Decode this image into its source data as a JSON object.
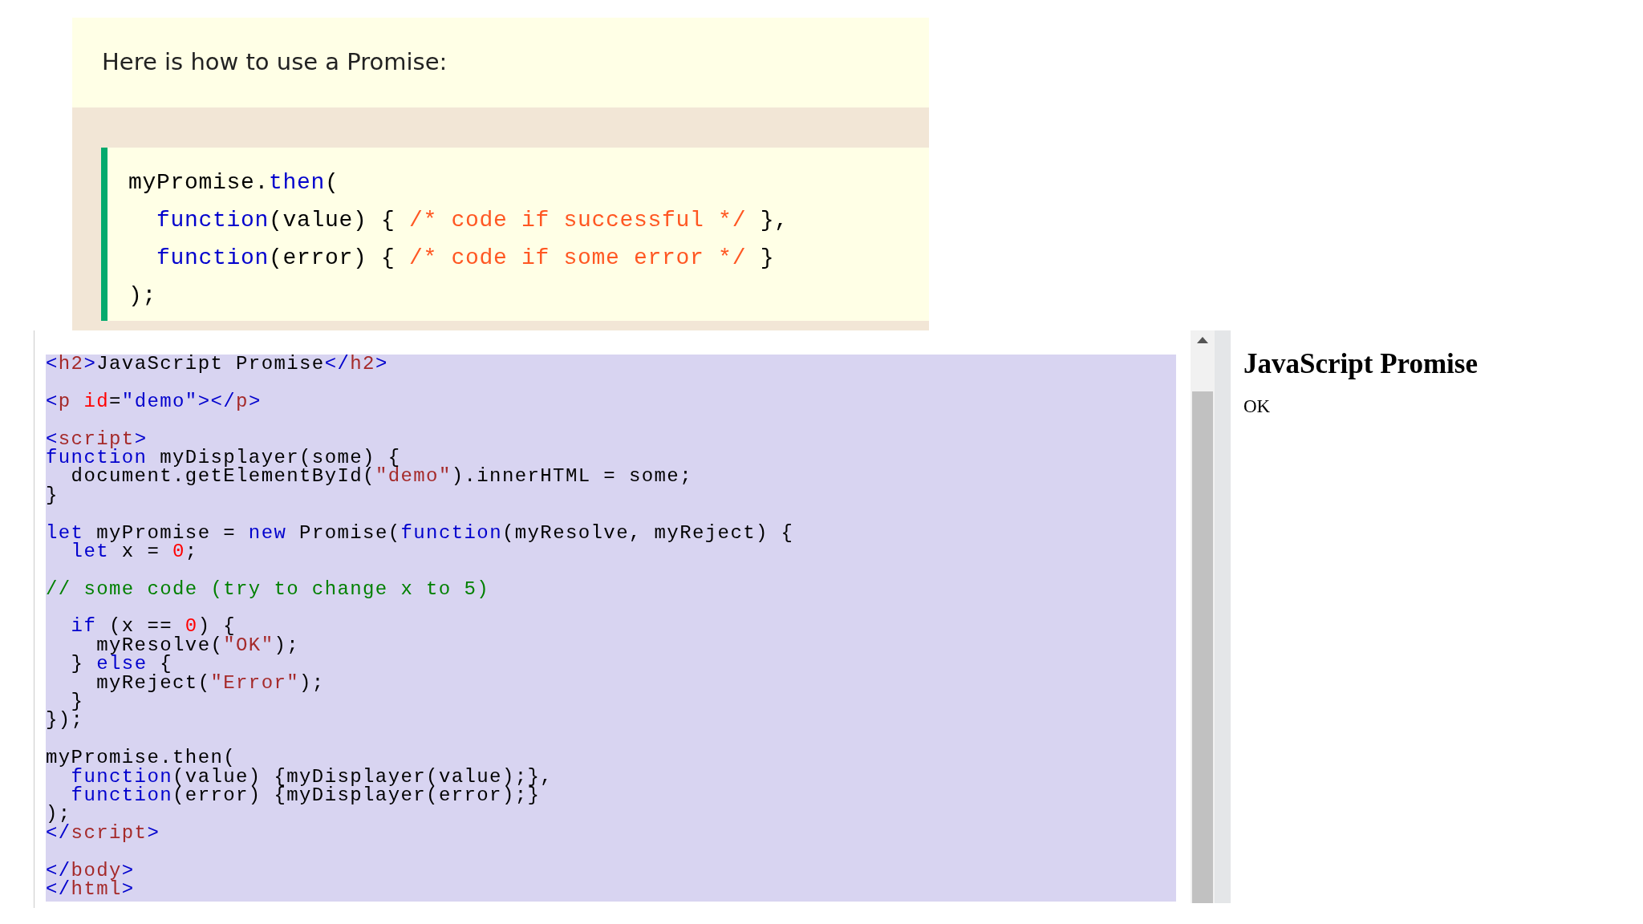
{
  "note": {
    "text": "Here is how to use a Promise:",
    "code_lines": [
      [
        {
          "kind": "plain",
          "text": "myPromise."
        },
        {
          "kind": "keyword",
          "text": "then"
        },
        {
          "kind": "plain",
          "text": "("
        }
      ],
      [
        {
          "kind": "keyword",
          "text": "  function"
        },
        {
          "kind": "plain",
          "text": "(value) { "
        },
        {
          "kind": "note_comment",
          "text": "/* code if successful */"
        },
        {
          "kind": "plain",
          "text": " },"
        }
      ],
      [
        {
          "kind": "keyword",
          "text": "  function"
        },
        {
          "kind": "plain",
          "text": "(error) { "
        },
        {
          "kind": "note_comment",
          "text": "/* code if some error */"
        },
        {
          "kind": "plain",
          "text": " }"
        }
      ],
      [
        {
          "kind": "plain",
          "text": ");"
        }
      ]
    ]
  },
  "editor": {
    "blocks": [
      [
        [
          {
            "kind": "bracket",
            "text": "<"
          },
          {
            "kind": "tag",
            "text": "h2"
          },
          {
            "kind": "bracket",
            "text": ">"
          },
          {
            "kind": "plain",
            "text": "JavaScript Promise"
          },
          {
            "kind": "bracket",
            "text": "</"
          },
          {
            "kind": "tag",
            "text": "h2"
          },
          {
            "kind": "bracket",
            "text": ">"
          }
        ]
      ],
      [
        [
          {
            "kind": "bracket",
            "text": "<"
          },
          {
            "kind": "tag",
            "text": "p"
          },
          {
            "kind": "attr",
            "text": " id"
          },
          {
            "kind": "plain",
            "text": "="
          },
          {
            "kind": "attrval",
            "text": "\"demo\""
          },
          {
            "kind": "bracket",
            "text": "></"
          },
          {
            "kind": "tag",
            "text": "p"
          },
          {
            "kind": "bracket",
            "text": ">"
          }
        ]
      ],
      [
        [
          {
            "kind": "bracket",
            "text": "<"
          },
          {
            "kind": "tag",
            "text": "script"
          },
          {
            "kind": "bracket",
            "text": ">"
          }
        ],
        [
          {
            "kind": "keyword",
            "text": "function"
          },
          {
            "kind": "plain",
            "text": " myDisplayer(some) {"
          }
        ],
        [
          {
            "kind": "plain",
            "text": "  document.getElementById("
          },
          {
            "kind": "string",
            "text": "\"demo\""
          },
          {
            "kind": "plain",
            "text": ").innerHTML = some;"
          }
        ],
        [
          {
            "kind": "plain",
            "text": "}"
          }
        ]
      ],
      [
        [
          {
            "kind": "keyword",
            "text": "let"
          },
          {
            "kind": "plain",
            "text": " myPromise = "
          },
          {
            "kind": "keyword",
            "text": "new"
          },
          {
            "kind": "plain",
            "text": " Promise("
          },
          {
            "kind": "keyword",
            "text": "function"
          },
          {
            "kind": "plain",
            "text": "(myResolve, myReject) {"
          }
        ],
        [
          {
            "kind": "keyword",
            "text": "  let"
          },
          {
            "kind": "plain",
            "text": " x = "
          },
          {
            "kind": "number",
            "text": "0"
          },
          {
            "kind": "plain",
            "text": ";"
          }
        ]
      ],
      [
        [
          {
            "kind": "comment",
            "text": "// some code (try to change x to 5)"
          }
        ]
      ],
      [
        [
          {
            "kind": "keyword",
            "text": "  if"
          },
          {
            "kind": "plain",
            "text": " (x == "
          },
          {
            "kind": "number",
            "text": "0"
          },
          {
            "kind": "plain",
            "text": ") {"
          }
        ],
        [
          {
            "kind": "plain",
            "text": "    myResolve("
          },
          {
            "kind": "string",
            "text": "\"OK\""
          },
          {
            "kind": "plain",
            "text": ");"
          }
        ],
        [
          {
            "kind": "plain",
            "text": "  } "
          },
          {
            "kind": "keyword",
            "text": "else"
          },
          {
            "kind": "plain",
            "text": " {"
          }
        ],
        [
          {
            "kind": "plain",
            "text": "    myReject("
          },
          {
            "kind": "string",
            "text": "\"Error\""
          },
          {
            "kind": "plain",
            "text": ");"
          }
        ],
        [
          {
            "kind": "plain",
            "text": "  }"
          }
        ],
        [
          {
            "kind": "plain",
            "text": "});"
          }
        ]
      ],
      [
        [
          {
            "kind": "plain",
            "text": "myPromise.then("
          }
        ],
        [
          {
            "kind": "keyword",
            "text": "  function"
          },
          {
            "kind": "plain",
            "text": "(value) {myDisplayer(value);},"
          }
        ],
        [
          {
            "kind": "keyword",
            "text": "  function"
          },
          {
            "kind": "plain",
            "text": "(error) {myDisplayer(error);}"
          }
        ],
        [
          {
            "kind": "plain",
            "text": ");"
          }
        ],
        [
          {
            "kind": "bracket",
            "text": "</"
          },
          {
            "kind": "tag",
            "text": "script"
          },
          {
            "kind": "bracket",
            "text": ">"
          }
        ]
      ],
      [
        [
          {
            "kind": "bracket",
            "text": "</"
          },
          {
            "kind": "tag",
            "text": "body"
          },
          {
            "kind": "bracket",
            "text": ">"
          }
        ],
        [
          {
            "kind": "bracket",
            "text": "</"
          },
          {
            "kind": "tag",
            "text": "html"
          },
          {
            "kind": "bracket",
            "text": ">"
          }
        ]
      ]
    ]
  },
  "result": {
    "heading": "JavaScript Promise",
    "output": "OK"
  }
}
